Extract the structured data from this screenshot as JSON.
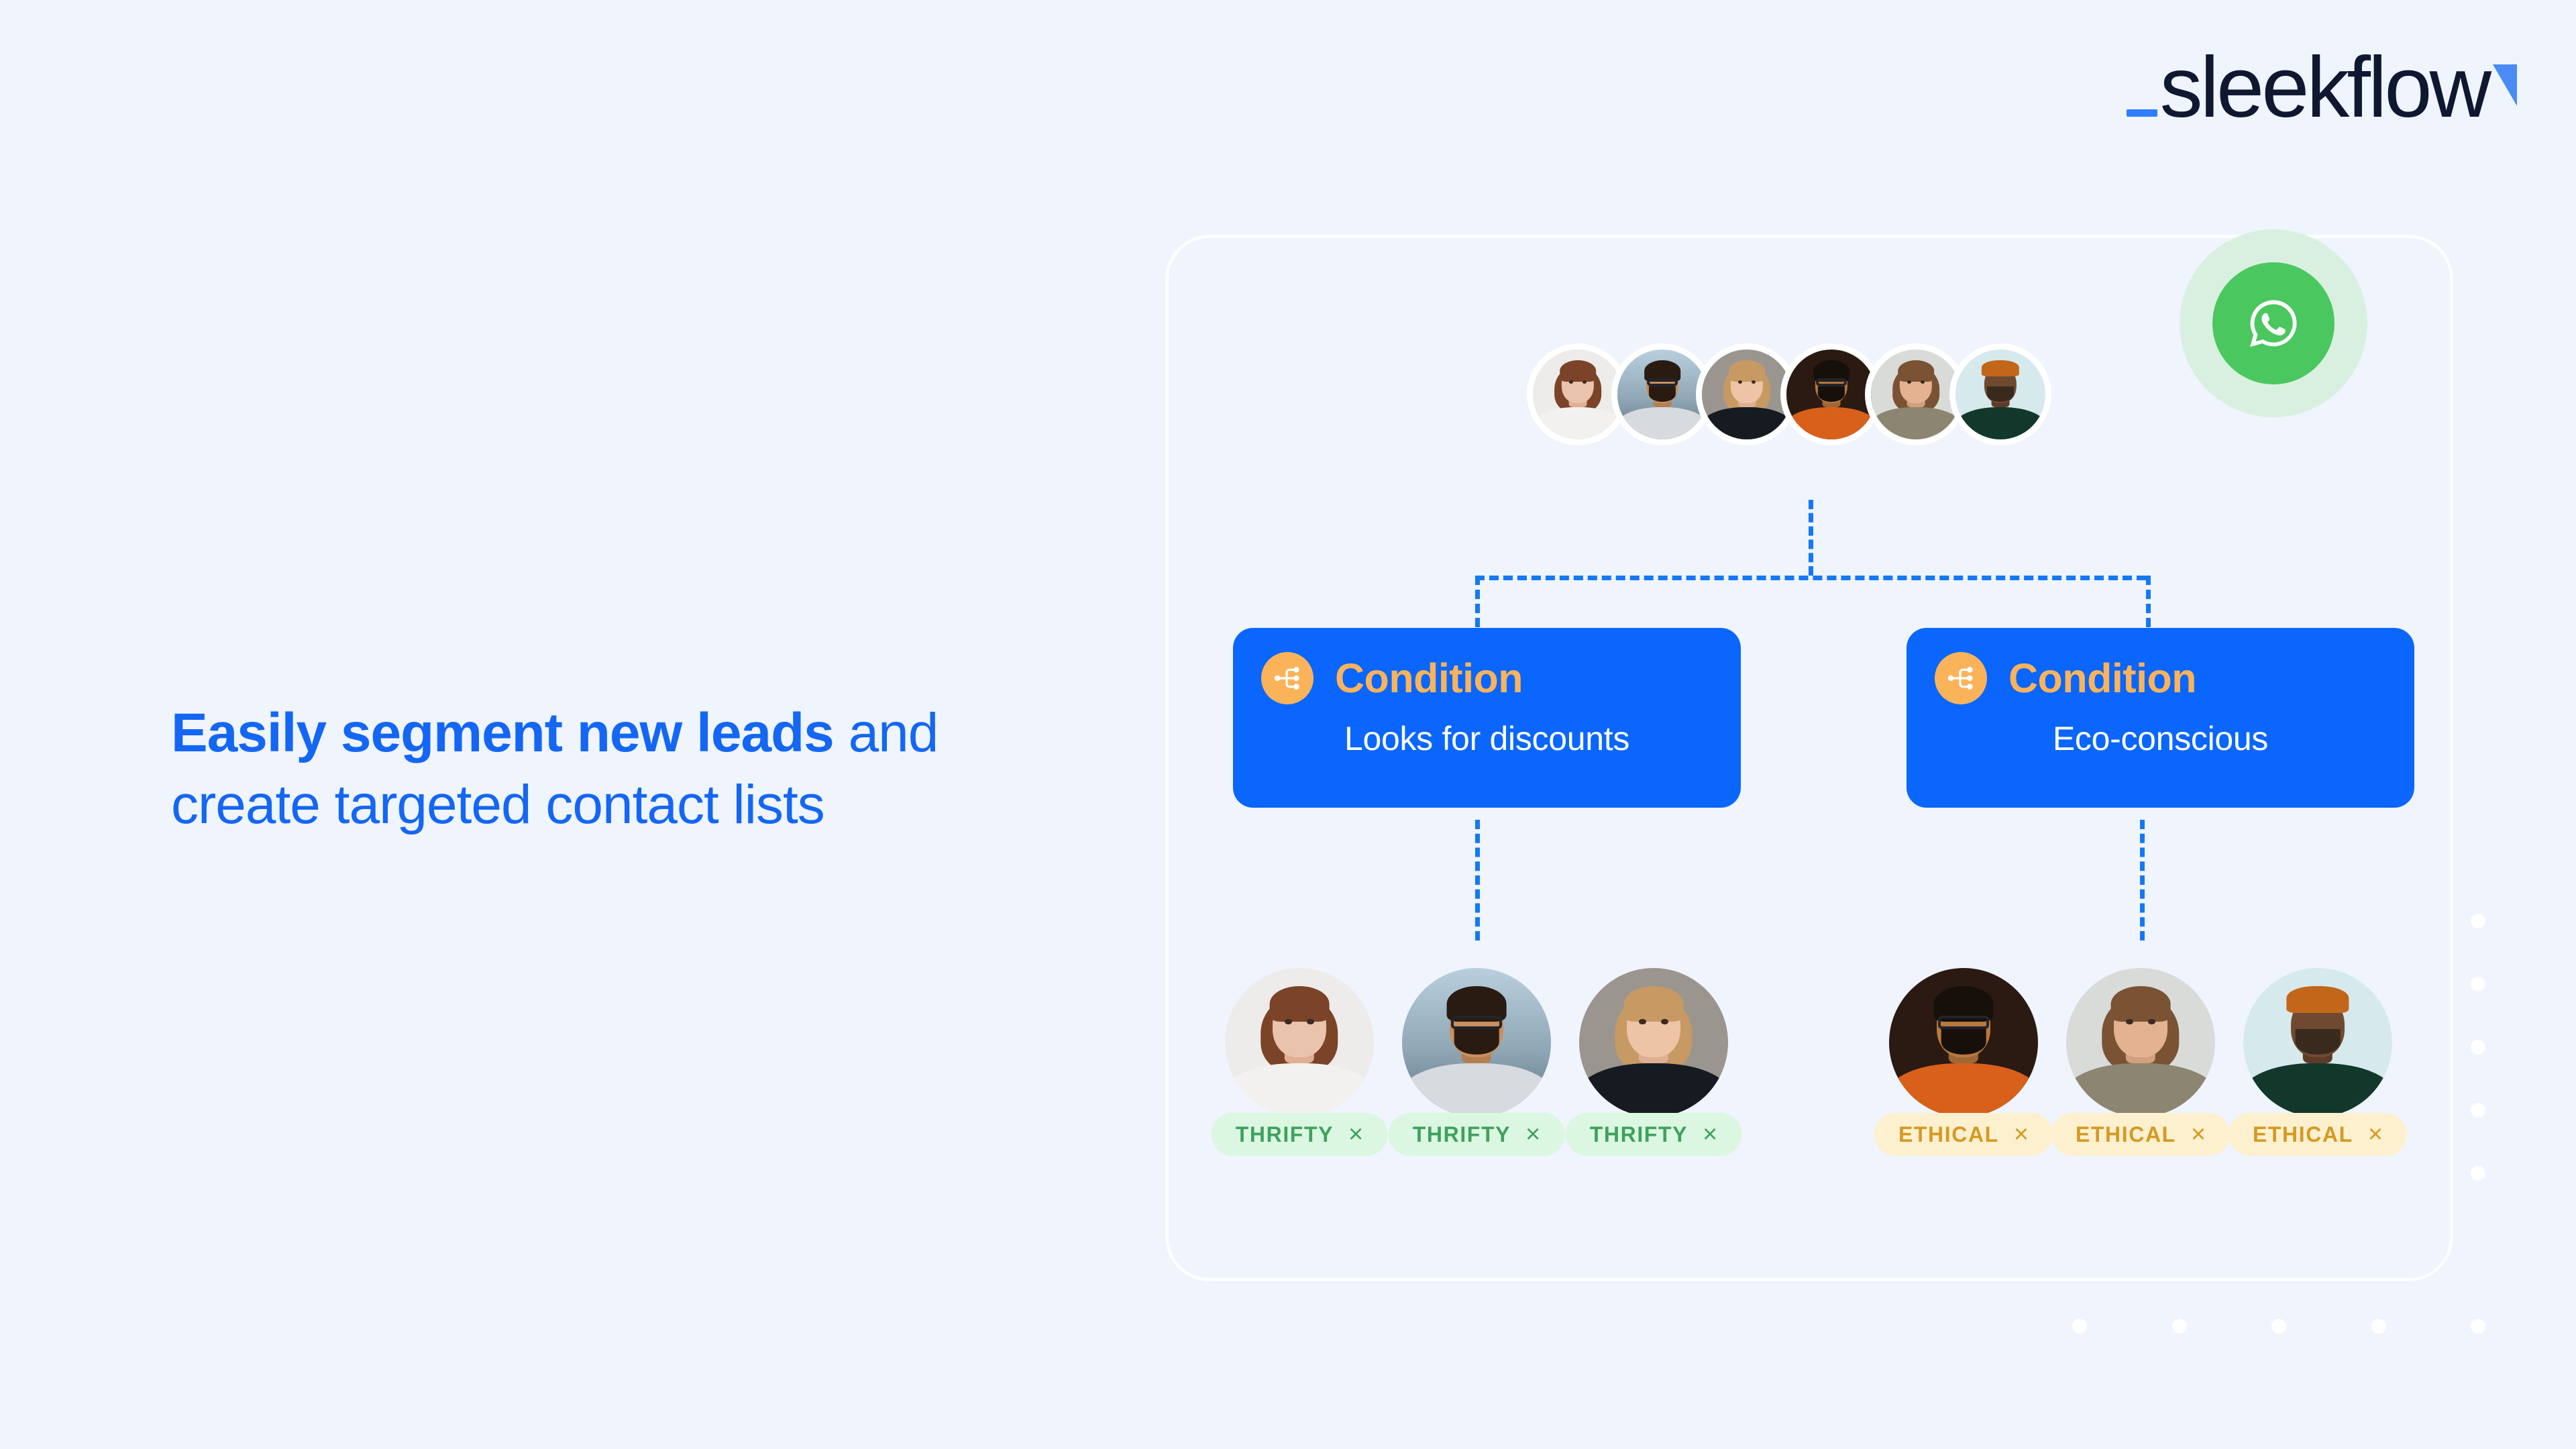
{
  "page": {
    "background_color": "#eff4fd",
    "accent_blue": "#1466f5",
    "card_blue": "#0a66fd",
    "icon_orange": "#fbb35a"
  },
  "logo": {
    "underscore": "_",
    "wordmark": "sleekflow",
    "mark_color": "#4b8bf5",
    "word_color": "#101730",
    "underscore_color": "#2f7dfb"
  },
  "headline": {
    "bold_part": "Easily segment new leads",
    "rest_part": " and create targeted contact lists"
  },
  "channel_badge": {
    "icon": "whatsapp-icon",
    "circle_color": "#4bc75f",
    "halo_color": "#d9f0e0"
  },
  "lead_cluster": {
    "count": 6,
    "avatars": [
      {
        "name": "avatar-lead-1",
        "bg": "#edecea",
        "skin": "#e9c3ab",
        "hair": "#7b4327",
        "top": "#f2f1ef",
        "long_hair": true
      },
      {
        "name": "avatar-lead-2",
        "bg": "#9db7c9",
        "skin": "#c98f5f",
        "hair": "#2a1b12",
        "top": "#d7dade",
        "glasses": true,
        "beard": true
      },
      {
        "name": "avatar-lead-3",
        "bg": "#9b958f",
        "skin": "#edc4a5",
        "hair": "#c79a63",
        "top": "#161b22",
        "long_hair": true
      },
      {
        "name": "avatar-lead-4",
        "bg": "#2a1a12",
        "skin": "#b9783f",
        "hair": "#17100a",
        "top": "#d8601a",
        "glasses": true,
        "beard": true
      },
      {
        "name": "avatar-lead-5",
        "bg": "#d9dbd9",
        "skin": "#e3b291",
        "hair": "#7a5334",
        "top": "#8c8572",
        "long_hair": true
      },
      {
        "name": "avatar-lead-6",
        "bg": "#d6eaee",
        "skin": "#6f4a31",
        "hair": "#2a1c13",
        "top": "#12382c",
        "hat": "#c2671a",
        "beard": true
      }
    ]
  },
  "branches": [
    {
      "card": {
        "name": "condition-card-discounts",
        "icon": "branch-icon",
        "title": "Condition",
        "subtitle": "Looks for discounts"
      },
      "tag": {
        "label": "THRIFTY",
        "close": "×",
        "bg": "#dbf7e1",
        "fg": "#3fa15e"
      },
      "results": [
        {
          "name": "avatar-thrifty-1",
          "bg": "#edecea",
          "skin": "#e9c3ab",
          "hair": "#7b4327",
          "top": "#f2f1ef",
          "long_hair": true
        },
        {
          "name": "avatar-thrifty-2",
          "bg": "#9db7c9",
          "skin": "#c98f5f",
          "hair": "#2a1b12",
          "top": "#d7dade",
          "glasses": true,
          "beard": true
        },
        {
          "name": "avatar-thrifty-3",
          "bg": "#9b958f",
          "skin": "#edc4a5",
          "hair": "#c79a63",
          "top": "#161b22",
          "long_hair": true
        }
      ]
    },
    {
      "card": {
        "name": "condition-card-eco",
        "icon": "branch-icon",
        "title": "Condition",
        "subtitle": "Eco-conscious"
      },
      "tag": {
        "label": "ETHICAL",
        "close": "×",
        "bg": "#fdf0cf",
        "fg": "#d49a22"
      },
      "results": [
        {
          "name": "avatar-ethical-1",
          "bg": "#2a1a12",
          "skin": "#b9783f",
          "hair": "#17100a",
          "top": "#d8601a",
          "glasses": true,
          "beard": true
        },
        {
          "name": "avatar-ethical-2",
          "bg": "#d9dbd9",
          "skin": "#e3b291",
          "hair": "#7a5334",
          "top": "#8c8572",
          "long_hair": true
        },
        {
          "name": "avatar-ethical-3",
          "bg": "#d6eaee",
          "skin": "#6f4a31",
          "hair": "#2a1c13",
          "top": "#12382c",
          "hat": "#c2671a",
          "beard": true
        }
      ]
    }
  ],
  "decoration": {
    "dot_color": "#ffffff",
    "column_dots": 5,
    "row_dots": 5
  }
}
